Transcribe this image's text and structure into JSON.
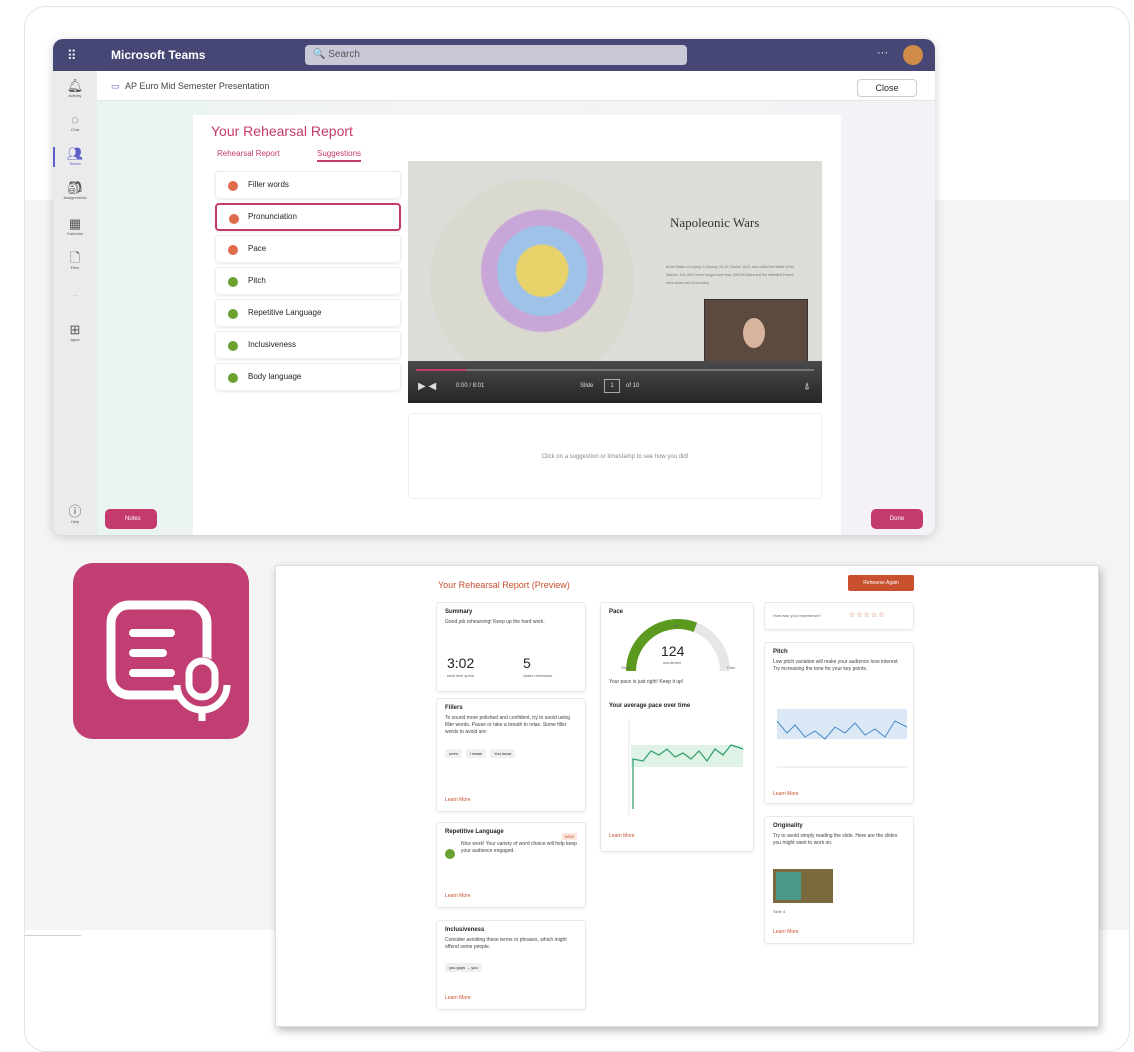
{
  "teams": {
    "app_name": "Microsoft Teams",
    "search_placeholder": "Search",
    "more": "···",
    "breadcrumb": "AP Euro Mid Semester Presentation",
    "close_label": "Close",
    "rail": [
      "Activity",
      "Chat",
      "Teams",
      "Assignments",
      "Calendar",
      "Files",
      "···",
      "Apps",
      "Help"
    ],
    "report": {
      "title": "Your Rehearsal Report",
      "tab_report": "Rehearsal Report",
      "tab_suggestions": "Suggestions",
      "suggestions": [
        {
          "label": "Filler words",
          "color": "#e06b4a"
        },
        {
          "label": "Pronunciation",
          "color": "#e06b4a"
        },
        {
          "label": "Pace",
          "color": "#e06b4a"
        },
        {
          "label": "Pitch",
          "color": "#6aa12e"
        },
        {
          "label": "Repetitive Language",
          "color": "#6aa12e"
        },
        {
          "label": "Inclusiveness",
          "color": "#6aa12e"
        },
        {
          "label": "Body language",
          "color": "#6aa12e"
        }
      ],
      "slide_title": "Napoleonic Wars",
      "slide_text": "At the Battle of Leipzig in Saxony, 16-19 October 1813, also called the Battle of the Nations, 191,000 French fought more than 300,000 Allies and the defeated French were driven out of Germany.",
      "time": "0:00 / 8:01",
      "slide_label": "Slide",
      "slide_num": "1",
      "slide_of": "of 10",
      "hint": "Click on a suggestion or timestamp to see how you did!",
      "notes_label": "Notes",
      "done_label": "Done"
    }
  },
  "preview": {
    "title": "Your Rehearsal Report (Preview)",
    "rehearse_again": "Rehearse Again",
    "summary": {
      "h": "Summary",
      "p": "Good job rehearsing! Keep up the hard work.",
      "time": "3:02",
      "time_label": "total time spent",
      "slides": "5",
      "slides_label": "slides rehearsed"
    },
    "fillers": {
      "h": "Fillers",
      "p": "To sound more polished and confident, try to avoid using filler words. Pause or take a breath to relax. Some filler words to avoid are:",
      "chips": [
        "umm",
        "I mean",
        "You know"
      ],
      "lm": "Learn More"
    },
    "repetitive": {
      "h": "Repetitive Language",
      "badge": "NEW",
      "p": "Nice work! Your variety of word choice will help keep your audience engaged.",
      "lm": "Learn More"
    },
    "inclusive": {
      "h": "Inclusiveness",
      "p": "Consider avoiding these terms or phrases, which might offend some people.",
      "chip": "you guys → you",
      "lm": "Learn More"
    },
    "pace": {
      "h": "Pace",
      "value": "124",
      "unit": "words/min",
      "min": "Slow",
      "mid": "OK",
      "max": "Fast",
      "note": "Your pace is just right! Keep it up!",
      "chart_h": "Your average pace over time",
      "lm": "Learn More"
    },
    "experience": {
      "q": "How was your experience?",
      "stars": "☆☆☆☆☆"
    },
    "pitch": {
      "h": "Pitch",
      "p": "Low pitch variation will make your audience lose interest. Try increasing the tone for your key points.",
      "lm": "Learn More"
    },
    "originality": {
      "h": "Originality",
      "p": "Try to avoid simply reading the slide. Here are the slides you might want to work on.",
      "slide": "Slide 4",
      "lm": "Learn More"
    }
  }
}
